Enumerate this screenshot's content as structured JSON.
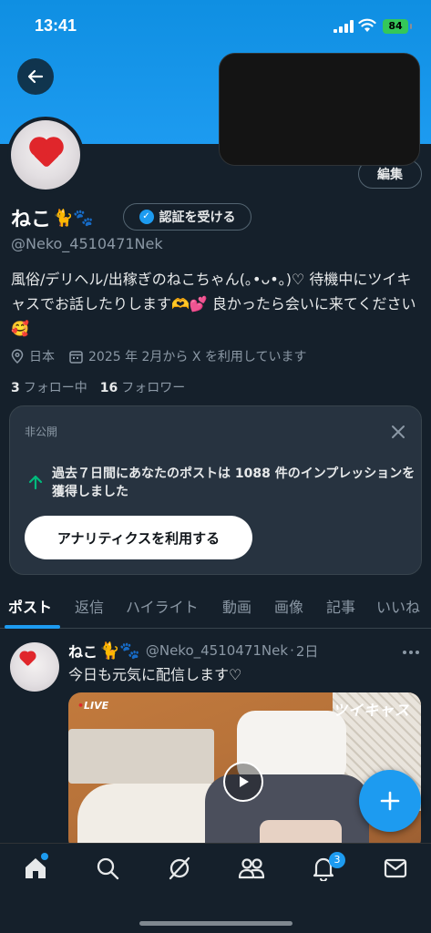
{
  "status_bar": {
    "time": "13:41",
    "battery": "84"
  },
  "profile": {
    "display_name": "ねこ",
    "name_emoji": "🐈🐾",
    "verify_button": "認証を受ける",
    "handle": "@Neko_4510471Nek",
    "edit_button": "編集",
    "bio": "風俗/デリヘル/出稼ぎのねこちゃん(｡•ᴗ•｡)♡ 待機中にツイキャスでお話したりします🫶💕 良かったら会いに来てください🥰",
    "location": "日本",
    "joined": "2025 年 2月から X を利用しています",
    "following_count": "3",
    "following_label": "フォロー中",
    "followers_count": "16",
    "followers_label": "フォロワー"
  },
  "analytics_card": {
    "private_label": "非公開",
    "message": "過去７日間にあなたのポストは 1088 件のインプレッションを獲得しました",
    "button_label": "アナリティクスを利用する"
  },
  "tabs": [
    {
      "label": "ポスト"
    },
    {
      "label": "返信"
    },
    {
      "label": "ハイライト"
    },
    {
      "label": "動画"
    },
    {
      "label": "画像"
    },
    {
      "label": "記事"
    },
    {
      "label": "いいね"
    }
  ],
  "post": {
    "name": "ねこ",
    "name_emoji": "🐈🐾",
    "handle": "@Neko_4510471Nek",
    "dot": "·",
    "time": "2日",
    "text": "今日も元気に配信します♡",
    "media_live_label": "LIVE",
    "media_brand_label": "ツイキャス"
  },
  "bottom_nav": {
    "notification_badge": "3"
  },
  "colors": {
    "accent": "#1d9bf0",
    "background": "#15202b",
    "card": "#273340",
    "secondary_text": "#8b98a5"
  },
  "icons": [
    "back-arrow-icon",
    "location-pin-icon",
    "calendar-icon",
    "close-icon",
    "arrow-up-icon",
    "more-icon",
    "play-icon",
    "plus-icon",
    "home-icon",
    "search-icon",
    "grok-icon",
    "communities-icon",
    "bell-icon",
    "mail-icon"
  ]
}
